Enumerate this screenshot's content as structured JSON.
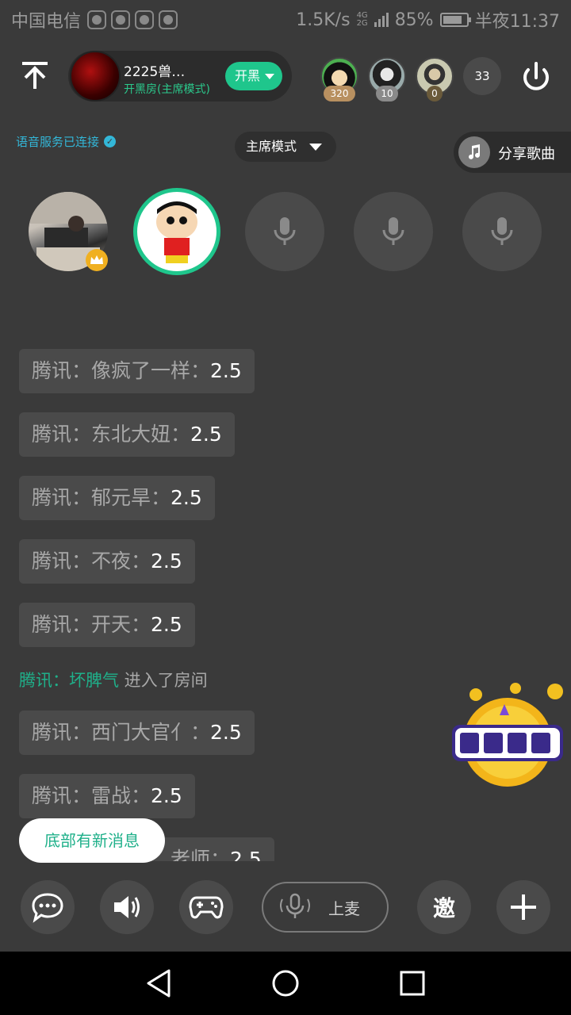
{
  "status_bar": {
    "carrier": "中国电信",
    "net_speed": "1.5K/s",
    "network_top": "4G",
    "network_bottom": "2G",
    "battery": "85%",
    "battery_level": 0.85,
    "time": "半夜11:37"
  },
  "header": {
    "room_name": "2225兽…",
    "room_sub": "开黑房(主席模式)",
    "room_button": "开黑",
    "top_users": [
      {
        "badge": "320"
      },
      {
        "badge": "10"
      },
      {
        "badge": "0"
      }
    ],
    "online_count": "33"
  },
  "info": {
    "voice_status": "语音服务已连接",
    "mode": "主席模式",
    "share_song": "分享歌曲"
  },
  "chat": {
    "messages": [
      {
        "source": "腾讯：",
        "text": "像疯了一样：",
        "value": "2.5"
      },
      {
        "source": "腾讯：",
        "text": "东北大妞：",
        "value": "2.5"
      },
      {
        "source": "腾讯：",
        "text": "郁元旱：",
        "value": "2.5"
      },
      {
        "source": "腾讯：",
        "text": "不夜：",
        "value": "2.5"
      },
      {
        "source": "腾讯：",
        "text": "开天：",
        "value": "2.5"
      },
      {
        "source": "腾讯：",
        "text": "西门大官亻：",
        "value": "2.5"
      },
      {
        "source": "腾讯：",
        "text": "雷战：",
        "value": "2.5"
      },
      {
        "source": "",
        "text": "…老师：",
        "value": "2.5"
      }
    ],
    "enter": {
      "source": "腾讯：",
      "user": "坏脾气",
      "action": " 进入了房间"
    },
    "new_message": "底部有新消息"
  },
  "toolbar": {
    "mic_up": "上麦",
    "invite": "邀"
  }
}
